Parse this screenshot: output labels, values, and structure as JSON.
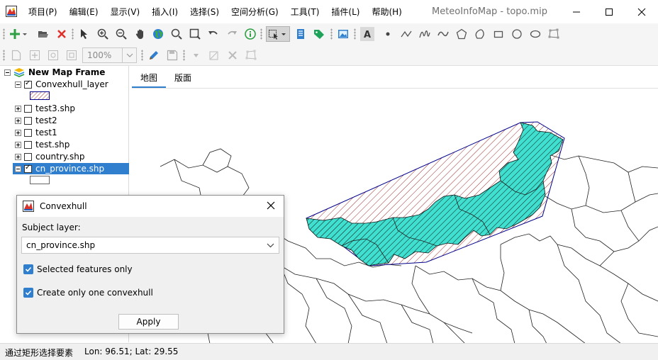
{
  "window": {
    "title": "MeteoInfoMap - topo.mip",
    "menu": [
      "项目(P)",
      "编辑(E)",
      "显示(V)",
      "插入(I)",
      "选择(S)",
      "空间分析(G)",
      "工具(T)",
      "插件(L)",
      "帮助(H)"
    ]
  },
  "toolbar": {
    "zoom_value": "100%"
  },
  "layer_tree": {
    "root": "New Map Frame",
    "layers": [
      {
        "name": "Convexhull_layer",
        "checked": true
      },
      {
        "name": "test3.shp",
        "checked": false
      },
      {
        "name": "test2",
        "checked": false
      },
      {
        "name": "test1",
        "checked": false
      },
      {
        "name": "test.shp",
        "checked": false
      },
      {
        "name": "country.shp",
        "checked": false
      },
      {
        "name": "cn_province.shp",
        "checked": true,
        "selected": true
      }
    ]
  },
  "tabs": [
    "地图",
    "版面"
  ],
  "dialog": {
    "title": "Convexhull",
    "subject_label": "Subject layer:",
    "subject_value": "cn_province.shp",
    "options": [
      "Selected features only",
      "Create only one convexhull"
    ],
    "apply_label": "Apply"
  },
  "status": {
    "message": "通过矩形选择要素",
    "coords": "Lon: 96.51; Lat: 29.55"
  },
  "colors": {
    "accent": "#2f7fce",
    "hull_stroke": "#00008b",
    "hull_hatch": "#a0302e",
    "selected_fill": "#40e0d0",
    "selected_hatch": "#101010"
  }
}
